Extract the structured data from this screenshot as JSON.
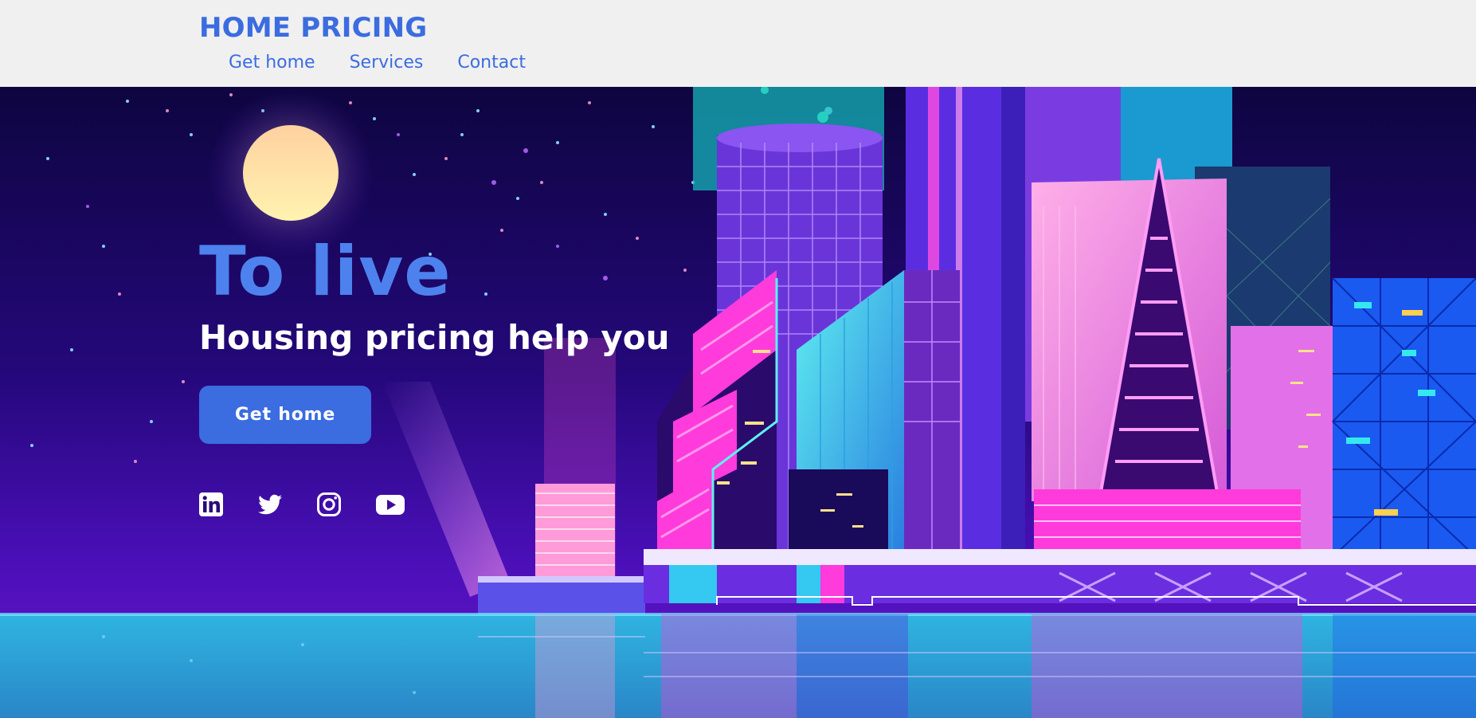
{
  "brand": {
    "logo": "HOME PRICING"
  },
  "nav": {
    "items": [
      {
        "label": "Get home"
      },
      {
        "label": "Services"
      },
      {
        "label": "Contact"
      }
    ]
  },
  "hero": {
    "title": "To live",
    "subtitle": "Housing pricing help you",
    "cta_label": "Get home",
    "social": [
      "linkedin-icon",
      "twitter-icon",
      "instagram-icon",
      "youtube-icon"
    ]
  },
  "colors": {
    "accent": "#3b6ce0",
    "header_bg": "#f0f0f0",
    "title": "#4d82ee",
    "hero_night": "#24087a",
    "water": "#2a9cd0",
    "neon_pink": "#ff2bd6",
    "neon_cyan": "#35e8f0"
  }
}
